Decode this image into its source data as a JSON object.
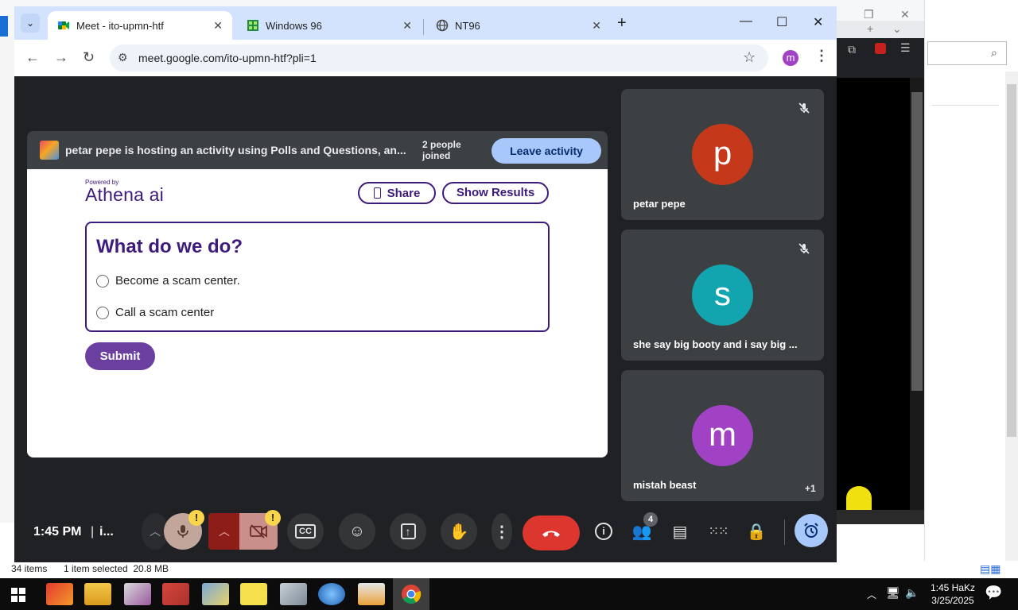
{
  "browser": {
    "tabs": [
      {
        "label": "Meet - ito-upmn-htf"
      },
      {
        "label": "Windows 96"
      },
      {
        "label": "NT96"
      }
    ],
    "url": "meet.google.com/ito-upmn-htf?pli=1",
    "profile_initial": "m"
  },
  "activity": {
    "banner_text": "petar pepe is hosting an activity using Polls and Questions, an...",
    "people_joined": "2 people joined",
    "leave_label": "Leave activity"
  },
  "poll": {
    "brand_small": "Powered by",
    "brand_big": "Athena ai",
    "share_label": "Share",
    "show_results_label": "Show Results",
    "question": "What do we do?",
    "options": [
      "Become a scam center.",
      "Call a scam center"
    ],
    "submit_label": "Submit"
  },
  "participants": [
    {
      "initial": "p",
      "name": "petar pepe",
      "color": "#c5391a"
    },
    {
      "initial": "s",
      "name": "she say big booty and i say big ...",
      "color": "#12a4af"
    },
    {
      "initial": "m",
      "name": "mistah beast",
      "color": "#a142c4",
      "extra": "+1"
    }
  ],
  "controls": {
    "time": "1:45 PM",
    "separator": "|",
    "meeting_code_truncated": "i...",
    "mic_badge": "!",
    "cam_badge": "!",
    "people_count": "4"
  },
  "explorer_status": {
    "items": "34 items",
    "selected": "1 item selected  20.8 MB"
  },
  "taskbar": {
    "time": "1:45 HaKz",
    "date": "3/25/2025"
  },
  "colors": {
    "brand_purple": "#3e1b7a",
    "submit_purple": "#6b3fa0",
    "end_call_red": "#dc362e",
    "meet_bg": "#202124",
    "tab_strip": "#d3e3fd"
  }
}
